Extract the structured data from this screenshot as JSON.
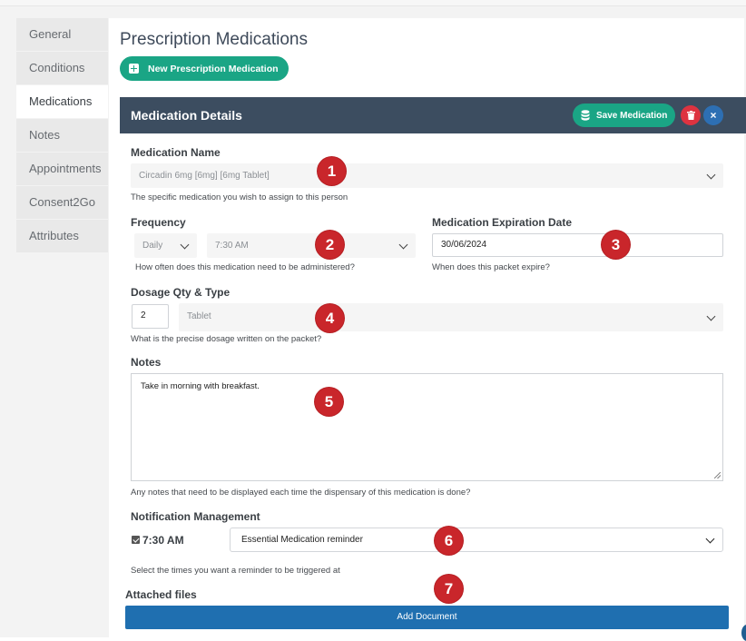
{
  "page": {
    "title": "Prescription Medications",
    "new_button": "New Prescription Medication"
  },
  "sidebar": {
    "items": [
      {
        "label": "General",
        "active": false
      },
      {
        "label": "Conditions",
        "active": false
      },
      {
        "label": "Medications",
        "active": true
      },
      {
        "label": "Notes",
        "active": false
      },
      {
        "label": "Appointments",
        "active": false
      },
      {
        "label": "Consent2Go",
        "active": false
      },
      {
        "label": "Attributes",
        "active": false
      }
    ]
  },
  "card": {
    "title": "Medication Details",
    "save_label": "Save Medication",
    "close_symbol": "×"
  },
  "form": {
    "medication_name": {
      "label": "Medication Name",
      "value": "Circadin 6mg [6mg] [6mg Tablet]",
      "help": "The specific medication you wish to assign to this person"
    },
    "frequency": {
      "label": "Frequency",
      "period": "Daily",
      "time": "7:30 AM",
      "help": "How often does this medication need to be administered?"
    },
    "expiration": {
      "label": "Medication Expiration Date",
      "value": "30/06/2024",
      "help": "When does this packet expire?"
    },
    "dosage": {
      "label": "Dosage Qty & Type",
      "qty": "2",
      "type": "Tablet",
      "help": "What is the precise dosage written on the packet?"
    },
    "notes": {
      "label": "Notes",
      "value": "Take in morning with breakfast.",
      "help": "Any notes that need to be displayed each time the dispensary of this medication is done?"
    },
    "notification": {
      "label": "Notification Management",
      "time": "7:30 AM",
      "reminder": "Essential Medication reminder",
      "help": "Select the times you want a reminder to be triggered at"
    },
    "attachments": {
      "label": "Attached files",
      "button": "Add Document"
    }
  },
  "markers": [
    "1",
    "2",
    "3",
    "4",
    "5",
    "6",
    "7"
  ],
  "colors": {
    "header": "#3c4d60",
    "green": "#1aa585",
    "marker": "#c9262b",
    "blue_button": "#1f6fb0",
    "danger": "#dd3340"
  }
}
